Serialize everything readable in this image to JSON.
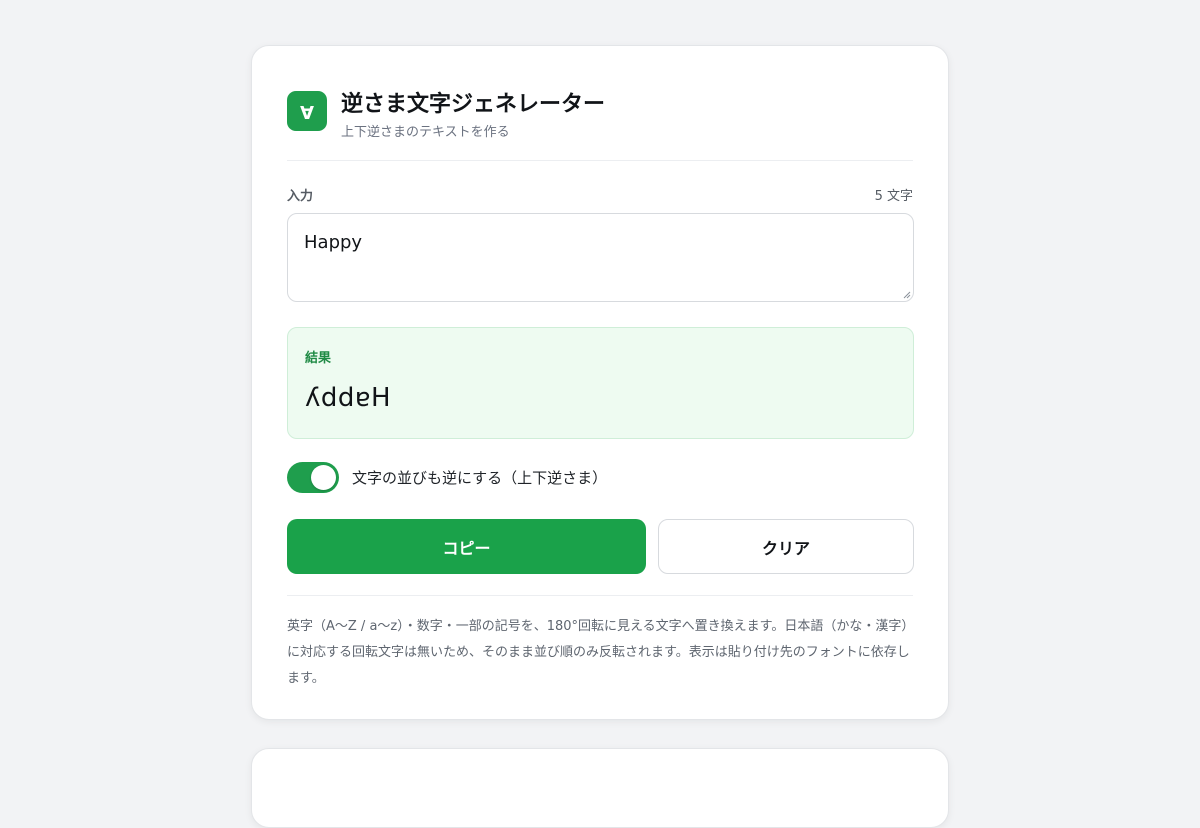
{
  "header": {
    "logo_glyph": "A",
    "title": "逆さま文字ジェネレーター",
    "subtitle": "上下逆さまのテキストを作る"
  },
  "input": {
    "label": "入力",
    "char_count": "5 文字",
    "value": "Happy"
  },
  "result": {
    "label": "結果",
    "value": "ʎddɐH"
  },
  "toggle": {
    "label": "文字の並びも逆にする（上下逆さま）",
    "on": true
  },
  "buttons": {
    "copy_label": "コピー",
    "clear_label": "クリア"
  },
  "note": "英字（A〜Z / a〜z）・数字・一部の記号を、180°回転に見える文字へ置き換えます。日本語（かな・漢字）に対応する回転文字は無いため、そのまま並び順のみ反転されます。表示は貼り付け先のフォントに依存します。",
  "colors": {
    "accent": "#1aa24a",
    "result_bg": "#eefbf1",
    "page_bg": "#f2f3f5"
  }
}
